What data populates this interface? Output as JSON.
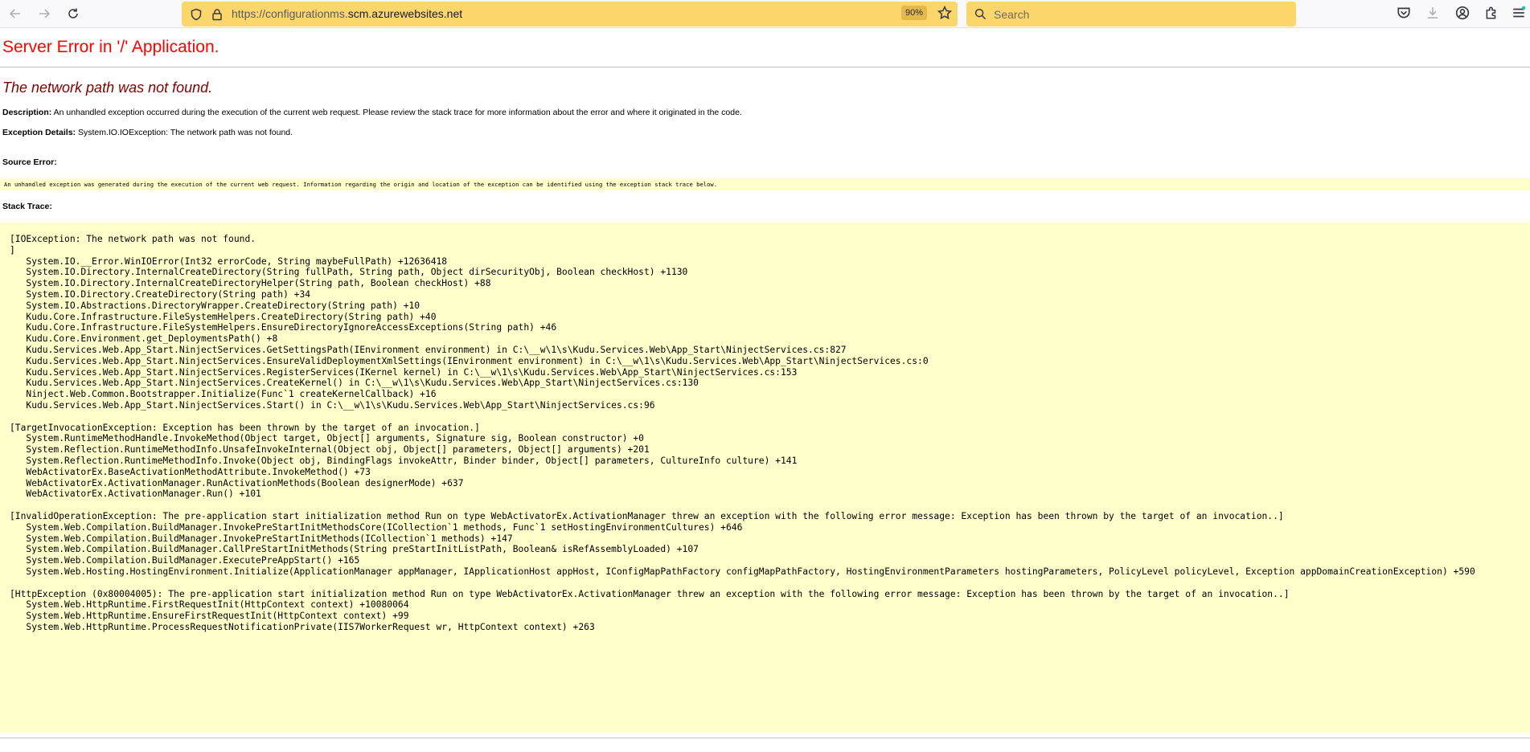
{
  "browser": {
    "url_prefix": "https://configurationms.",
    "url_host": "scm.azurewebsites.net",
    "zoom": "90%",
    "search_placeholder": "Search"
  },
  "page": {
    "title": "Server Error in '/' Application.",
    "error_heading": "The network path was not found.",
    "description_label": "Description:",
    "description_text": " An unhandled exception occurred during the execution of the current web request. Please review the stack trace for more information about the error and where it originated in the code.",
    "exception_label": "Exception Details:",
    "exception_text": " System.IO.IOException: The network path was not found.",
    "source_error_label": "Source Error:",
    "source_error_text": "An unhandled exception was generated during the execution of the current web request. Information regarding the origin and location of the exception can be identified using the exception stack trace below.",
    "stack_trace_label": "Stack Trace:"
  },
  "stack_trace": [
    "[IOException: The network path was not found.",
    "]",
    "   System.IO.__Error.WinIOError(Int32 errorCode, String maybeFullPath) +12636418",
    "   System.IO.Directory.InternalCreateDirectory(String fullPath, String path, Object dirSecurityObj, Boolean checkHost) +1130",
    "   System.IO.Directory.InternalCreateDirectoryHelper(String path, Boolean checkHost) +88",
    "   System.IO.Directory.CreateDirectory(String path) +34",
    "   System.IO.Abstractions.DirectoryWrapper.CreateDirectory(String path) +10",
    "   Kudu.Core.Infrastructure.FileSystemHelpers.CreateDirectory(String path) +40",
    "   Kudu.Core.Infrastructure.FileSystemHelpers.EnsureDirectoryIgnoreAccessExceptions(String path) +46",
    "   Kudu.Core.Environment.get_DeploymentsPath() +8",
    "   Kudu.Services.Web.App_Start.NinjectServices.GetSettingsPath(IEnvironment environment) in C:\\__w\\1\\s\\Kudu.Services.Web\\App_Start\\NinjectServices.cs:827",
    "   Kudu.Services.Web.App_Start.NinjectServices.EnsureValidDeploymentXmlSettings(IEnvironment environment) in C:\\__w\\1\\s\\Kudu.Services.Web\\App_Start\\NinjectServices.cs:0",
    "   Kudu.Services.Web.App_Start.NinjectServices.RegisterServices(IKernel kernel) in C:\\__w\\1\\s\\Kudu.Services.Web\\App_Start\\NinjectServices.cs:153",
    "   Kudu.Services.Web.App_Start.NinjectServices.CreateKernel() in C:\\__w\\1\\s\\Kudu.Services.Web\\App_Start\\NinjectServices.cs:130",
    "   Ninject.Web.Common.Bootstrapper.Initialize(Func`1 createKernelCallback) +16",
    "   Kudu.Services.Web.App_Start.NinjectServices.Start() in C:\\__w\\1\\s\\Kudu.Services.Web\\App_Start\\NinjectServices.cs:96",
    "",
    "[TargetInvocationException: Exception has been thrown by the target of an invocation.]",
    "   System.RuntimeMethodHandle.InvokeMethod(Object target, Object[] arguments, Signature sig, Boolean constructor) +0",
    "   System.Reflection.RuntimeMethodInfo.UnsafeInvokeInternal(Object obj, Object[] parameters, Object[] arguments) +201",
    "   System.Reflection.RuntimeMethodInfo.Invoke(Object obj, BindingFlags invokeAttr, Binder binder, Object[] parameters, CultureInfo culture) +141",
    "   WebActivatorEx.BaseActivationMethodAttribute.InvokeMethod() +73",
    "   WebActivatorEx.ActivationManager.RunActivationMethods(Boolean designerMode) +637",
    "   WebActivatorEx.ActivationManager.Run() +101",
    "",
    "[InvalidOperationException: The pre-application start initialization method Run on type WebActivatorEx.ActivationManager threw an exception with the following error message: Exception has been thrown by the target of an invocation..]",
    "   System.Web.Compilation.BuildManager.InvokePreStartInitMethodsCore(ICollection`1 methods, Func`1 setHostingEnvironmentCultures) +646",
    "   System.Web.Compilation.BuildManager.InvokePreStartInitMethods(ICollection`1 methods) +147",
    "   System.Web.Compilation.BuildManager.CallPreStartInitMethods(String preStartInitListPath, Boolean& isRefAssemblyLoaded) +107",
    "   System.Web.Compilation.BuildManager.ExecutePreAppStart() +165",
    "   System.Web.Hosting.HostingEnvironment.Initialize(ApplicationManager appManager, IApplicationHost appHost, IConfigMapPathFactory configMapPathFactory, HostingEnvironmentParameters hostingParameters, PolicyLevel policyLevel, Exception appDomainCreationException) +590",
    "",
    "[HttpException (0x80004005): The pre-application start initialization method Run on type WebActivatorEx.ActivationManager threw an exception with the following error message: Exception has been thrown by the target of an invocation..]",
    "   System.Web.HttpRuntime.FirstRequestInit(HttpContext context) +10080064",
    "   System.Web.HttpRuntime.EnsureFirstRequestInit(HttpContext context) +99",
    "   System.Web.HttpRuntime.ProcessRequestNotificationPrivate(IIS7WorkerRequest wr, HttpContext context) +263"
  ]
}
